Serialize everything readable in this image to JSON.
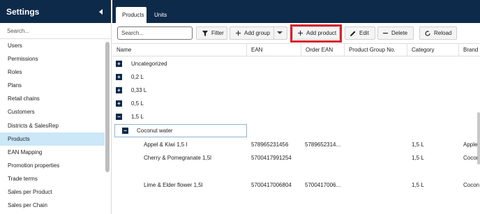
{
  "sidebar": {
    "title": "Settings",
    "search_placeholder": "Search...",
    "items": [
      {
        "label": "Users"
      },
      {
        "label": "Permissions"
      },
      {
        "label": "Roles"
      },
      {
        "label": "Plans"
      },
      {
        "label": "Retail chains"
      },
      {
        "label": "Customers"
      },
      {
        "label": "Districts & SalesRep"
      },
      {
        "label": "Products",
        "active": true
      },
      {
        "label": "EAN Mapping"
      },
      {
        "label": "Promotion properties"
      },
      {
        "label": "Trade terms"
      },
      {
        "label": "Sales per Product"
      },
      {
        "label": "Sales per Chain"
      }
    ]
  },
  "tabs": {
    "products": "Products",
    "units": "Units"
  },
  "toolbar": {
    "search_placeholder": "Search...",
    "filter": "Filter",
    "add_group": "Add group",
    "add_product": "Add product",
    "edit": "Edit",
    "delete": "Delete",
    "reload": "Reload"
  },
  "grid": {
    "columns": [
      "Name",
      "EAN",
      "Order EAN",
      "Product Group No.",
      "Category",
      "Brand"
    ],
    "groups": [
      {
        "label": "Uncategorized",
        "expanded": false
      },
      {
        "label": "0,2 L",
        "expanded": false
      },
      {
        "label": "0,33 L",
        "expanded": false
      },
      {
        "label": "0,5 L",
        "expanded": false
      },
      {
        "label": "1,5 L",
        "expanded": true
      }
    ],
    "subgroup": {
      "label": "Coconut water",
      "expanded": true
    },
    "rows": [
      {
        "name": "Appel & Kiwi 1,5 l",
        "ean": "578965231456",
        "order_ean": "5789652314...",
        "group_no": "",
        "category": "1,5 L",
        "brand": "Apple"
      },
      {
        "name": "Cherry & Pomegranate 1,5l",
        "ean": "5700417991254",
        "order_ean": "",
        "group_no": "",
        "category": "1,5 L",
        "brand": "Cocon"
      },
      {
        "name": "Lime & Elder flower 1,5l",
        "ean": "5700417006804",
        "order_ean": "5700417006...",
        "group_no": "",
        "category": "1,5 L",
        "brand": "Cocon"
      }
    ]
  },
  "colors": {
    "header_bg": "#0e2a4a",
    "active_item": "#cbe7f8",
    "highlight": "#d8202a"
  }
}
